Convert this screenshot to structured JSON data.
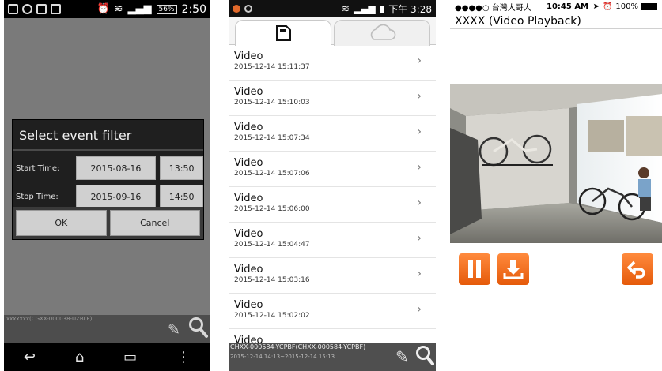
{
  "screen1": {
    "status": {
      "battery": "56%",
      "time": "2:50"
    },
    "dialog": {
      "title": "Select event filter",
      "start_label": "Start Time:",
      "start_date": "2015-08-16",
      "start_time": "13:50",
      "stop_label": "Stop Time:",
      "stop_date": "2015-09-16",
      "stop_time": "14:50",
      "ok_label": "OK",
      "cancel_label": "Cancel"
    },
    "bottom": {
      "device": "xxxxxxx(CGXX-000038-UZBLF)"
    }
  },
  "screen2": {
    "status": {
      "time": "下午 3:28"
    },
    "list": [
      {
        "title": "Video",
        "date": "2015-12-14 15:11:37"
      },
      {
        "title": "Video",
        "date": "2015-12-14 15:10:03"
      },
      {
        "title": "Video",
        "date": "2015-12-14 15:07:34"
      },
      {
        "title": "Video",
        "date": "2015-12-14 15:07:06"
      },
      {
        "title": "Video",
        "date": "2015-12-14 15:06:00"
      },
      {
        "title": "Video",
        "date": "2015-12-14 15:04:47"
      },
      {
        "title": "Video",
        "date": "2015-12-14 15:03:16"
      },
      {
        "title": "Video",
        "date": "2015-12-14 15:02:02"
      },
      {
        "title": "Video",
        "date": ""
      }
    ],
    "bottom": {
      "device": "CHXX-000584-YCPBF(CHXX-000584-YCPBF)",
      "range": "2015-12-14 14:13~2015-12-14 15:13"
    }
  },
  "screen3": {
    "status": {
      "carrier": "●●●●○ 台灣大哥大",
      "time": "10:45 AM",
      "battery": "100%"
    },
    "title": "XXXX (Video Playback)"
  }
}
